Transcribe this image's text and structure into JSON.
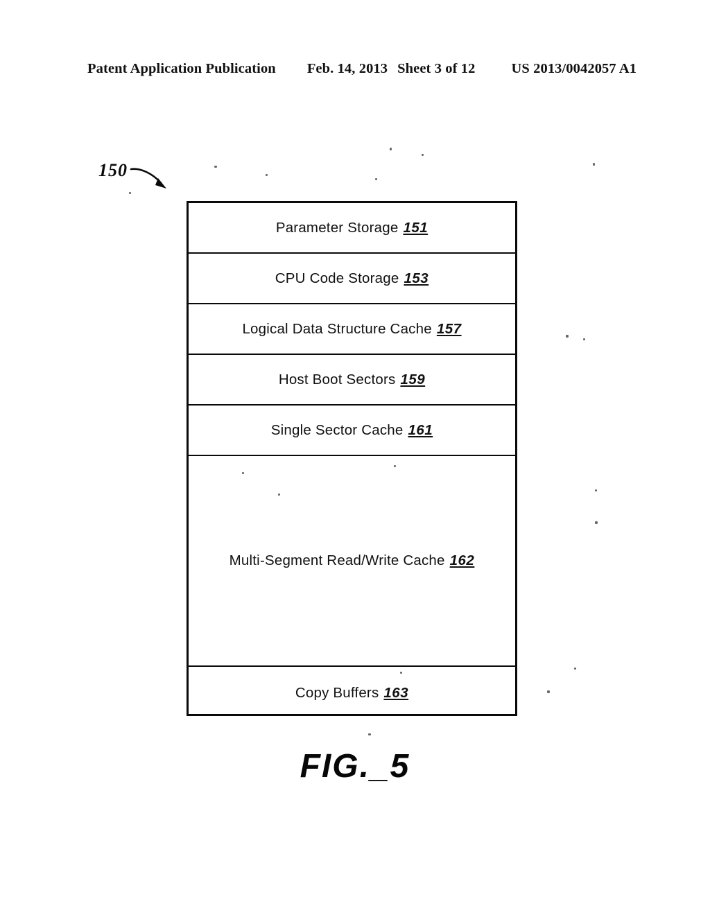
{
  "header": {
    "publication": "Patent Application Publication",
    "date": "Feb. 14, 2013",
    "sheet": "Sheet 3 of 12",
    "document_number": "US 2013/0042057 A1"
  },
  "figure": {
    "caption": "FIG._5",
    "callout_ref": "150",
    "callout_arrow_icon": "curved-arrow-icon"
  },
  "memory_map": {
    "rows": [
      {
        "label": "Parameter Storage",
        "ref": "151"
      },
      {
        "label": "CPU Code Storage",
        "ref": "153"
      },
      {
        "label": "Logical Data Structure Cache",
        "ref": "157"
      },
      {
        "label": "Host Boot Sectors",
        "ref": "159"
      },
      {
        "label": "Single Sector Cache",
        "ref": "161"
      },
      {
        "label": "Multi-Segment Read/Write Cache",
        "ref": "162"
      },
      {
        "label": "Copy Buffers",
        "ref": "163"
      }
    ]
  },
  "colors": {
    "ink": "#0a0a0a",
    "page": "#ffffff"
  }
}
